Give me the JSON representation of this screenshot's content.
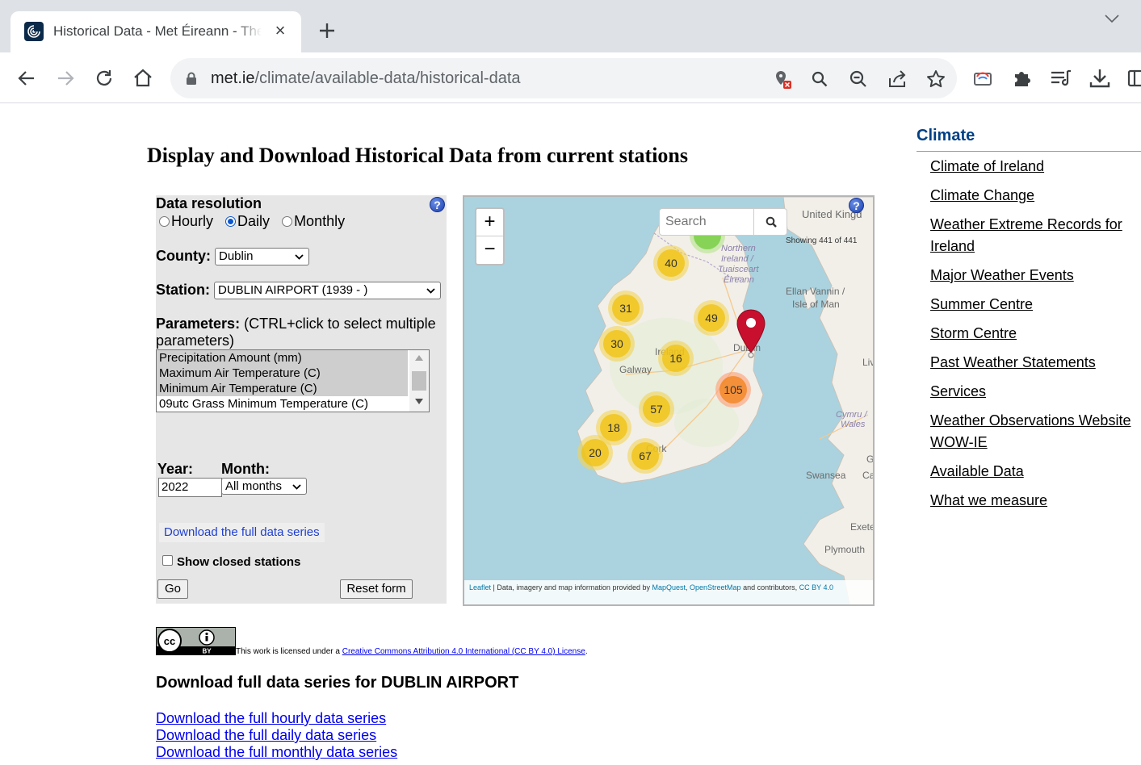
{
  "browser": {
    "tab_title": "Historical Data - Met Éireann - The Irish Meteorological Service",
    "url_host": "met.ie",
    "url_path": "/climate/available-data/historical-data"
  },
  "page": {
    "title": "Display and Download Historical Data from current stations"
  },
  "form": {
    "resolution_label": "Data resolution",
    "resolution_options": [
      "Hourly",
      "Daily",
      "Monthly"
    ],
    "resolution_selected": "Daily",
    "county_label": "County:",
    "county_value": "Dublin",
    "station_label": "Station:",
    "station_value": "DUBLIN AIRPORT (1939 - )",
    "parameters_label": "Parameters:",
    "parameters_hint": "(CTRL+click to select multiple parameters)",
    "parameters": [
      {
        "label": "Precipitation Amount (mm)",
        "selected": true
      },
      {
        "label": "Maximum Air Temperature (C)",
        "selected": true
      },
      {
        "label": "Minimum Air Temperature (C)",
        "selected": true
      },
      {
        "label": "09utc Grass Minimum Temperature (C)",
        "selected": false
      }
    ],
    "year_label": "Year:",
    "year_value": "2022",
    "month_label": "Month:",
    "month_value": "All months",
    "download_full_label": "Download the full data series",
    "show_closed_label": "Show closed stations",
    "go_label": "Go",
    "reset_label": "Reset form",
    "help_label": "?"
  },
  "map": {
    "zoom_in": "+",
    "zoom_out": "−",
    "search_placeholder": "Search",
    "showing": "Showing 441 of 441",
    "help_label": "?",
    "clusters": [
      "40",
      "31",
      "49",
      "30",
      "16",
      "105",
      "57",
      "18",
      "20",
      "67"
    ],
    "place_labels": {
      "united_kingdom": "United Kingd",
      "northern_ireland": [
        "Northern",
        "Ireland /",
        "Tuaisceart",
        "Éireann"
      ],
      "ellan_vannin": [
        "Ellan Vannin /",
        "Isle of Man"
      ],
      "ireland": "Ireland",
      "galway": "Galway",
      "dublin": "Dublin",
      "cork": "Cork",
      "cymru": [
        "Cymru /",
        "Wales"
      ],
      "swansea": "Swansea",
      "exeter": "Exete",
      "plymouth": "Plymouth",
      "liv": "Liv",
      "ca": "Ca",
      "g": "G"
    },
    "attribution": {
      "leaflet": "Leaflet",
      "text1": " | Data, imagery and map information provided by ",
      "mapquest": "MapQuest",
      "sep": ", ",
      "osm": "OpenStreetMap",
      "text2": " and contributors, ",
      "cc": "CC BY 4.0"
    }
  },
  "license": {
    "prefix": "This work is licensed under a ",
    "link": "Creative Commons Attribution 4.0 International (CC BY 4.0) License",
    "suffix": ".",
    "badge_text": "BY"
  },
  "downloads": {
    "heading": "Download full data series for DUBLIN AIRPORT",
    "links": [
      "Download the full hourly data series",
      "Download the full daily data series",
      "Download the full monthly data series"
    ]
  },
  "sidebar": {
    "title": "Climate",
    "items": [
      "Climate of Ireland",
      "Climate Change",
      "Weather Extreme Records for Ireland",
      "Major Weather Events",
      "Summer Centre",
      "Storm Centre",
      "Past Weather Statements",
      "Services",
      "Weather Observations Website WOW-IE",
      "Available Data",
      "What we measure"
    ]
  },
  "colors": {
    "sidebar_title": "#004085",
    "link": "#0000ee",
    "marker": "#c8102e",
    "cluster_yellow": "#f0c20c",
    "cluster_orange": "#f18017"
  }
}
